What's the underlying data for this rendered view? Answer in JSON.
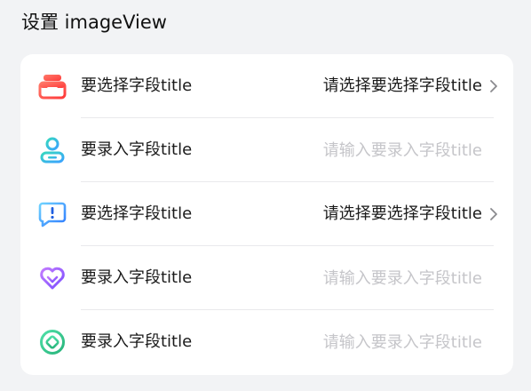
{
  "section": {
    "title": "设置 imageView"
  },
  "rows": [
    {
      "icon": "inbox-tray-icon",
      "type": "select",
      "label": "要选择字段title",
      "value": "请选择要选择字段title",
      "chevron": "chevron-right-icon"
    },
    {
      "icon": "user-profile-icon",
      "type": "input",
      "label": "要录入字段title",
      "value": "",
      "placeholder": "请输入要录入字段title"
    },
    {
      "icon": "message-alert-icon",
      "type": "select",
      "label": "要选择字段title",
      "value": "请选择要选择字段title",
      "chevron": "chevron-right-icon"
    },
    {
      "icon": "heart-icon",
      "type": "input",
      "label": "要录入字段title",
      "value": "",
      "placeholder": "请输入要录入字段title"
    },
    {
      "icon": "target-circle-icon",
      "type": "input",
      "label": "要录入字段title",
      "value": "",
      "placeholder": "请输入要录入字段title"
    }
  ],
  "colors": {
    "background": "#f2f3f5",
    "card": "#ffffff",
    "text_primary": "#1a1a1a",
    "placeholder": "#c5c5c9",
    "divider": "#e9e9ec",
    "chevron": "#8a8a8e",
    "icon_red_start": "#ff6a5f",
    "icon_red_end": "#ff3b3b",
    "icon_teal_start": "#3ad0c4",
    "icon_teal_end": "#4aa0ff",
    "icon_blue_start": "#5ec8ff",
    "icon_blue_end": "#2f7cff",
    "icon_purple_start": "#b46bff",
    "icon_purple_end": "#7a4dff",
    "icon_green_start": "#42d9a0",
    "icon_green_end": "#2bb57a"
  }
}
